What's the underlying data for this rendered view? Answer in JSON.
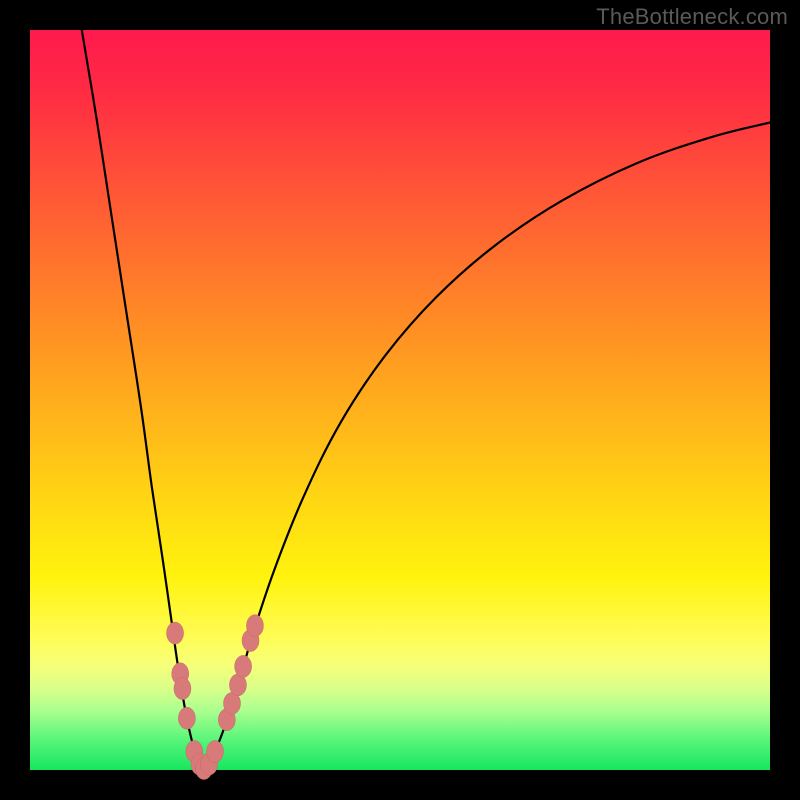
{
  "watermark": "TheBottleneck.com",
  "colors": {
    "frame": "#000000",
    "curve": "#000000",
    "marker_fill": "#d87a7a",
    "marker_stroke": "#c46868"
  },
  "chart_data": {
    "type": "line",
    "title": "",
    "xlabel": "",
    "ylabel": "",
    "xlim": [
      0,
      100
    ],
    "ylim": [
      0,
      100
    ],
    "note": "Axes are unlabeled in the image; coordinates below are read in percent of the inner plot area (0,0 = bottom-left, 100,100 = top-right).",
    "series": [
      {
        "name": "left-branch",
        "type": "line",
        "points": [
          {
            "x": 7.0,
            "y": 100.0
          },
          {
            "x": 9.0,
            "y": 88.0
          },
          {
            "x": 11.0,
            "y": 75.0
          },
          {
            "x": 13.0,
            "y": 62.0
          },
          {
            "x": 15.0,
            "y": 49.0
          },
          {
            "x": 16.5,
            "y": 38.0
          },
          {
            "x": 18.0,
            "y": 28.0
          },
          {
            "x": 19.0,
            "y": 21.0
          },
          {
            "x": 20.0,
            "y": 14.0
          },
          {
            "x": 21.0,
            "y": 8.0
          },
          {
            "x": 22.0,
            "y": 3.5
          },
          {
            "x": 23.0,
            "y": 0.8
          },
          {
            "x": 23.5,
            "y": 0.0
          }
        ]
      },
      {
        "name": "right-branch",
        "type": "line",
        "points": [
          {
            "x": 23.5,
            "y": 0.0
          },
          {
            "x": 24.5,
            "y": 1.5
          },
          {
            "x": 26.0,
            "y": 5.0
          },
          {
            "x": 28.0,
            "y": 11.0
          },
          {
            "x": 30.0,
            "y": 18.0
          },
          {
            "x": 33.0,
            "y": 27.0
          },
          {
            "x": 37.0,
            "y": 37.0
          },
          {
            "x": 42.0,
            "y": 47.0
          },
          {
            "x": 48.0,
            "y": 56.0
          },
          {
            "x": 55.0,
            "y": 64.0
          },
          {
            "x": 63.0,
            "y": 71.0
          },
          {
            "x": 72.0,
            "y": 77.0
          },
          {
            "x": 82.0,
            "y": 82.0
          },
          {
            "x": 92.0,
            "y": 85.5
          },
          {
            "x": 100.0,
            "y": 87.5
          }
        ]
      },
      {
        "name": "markers",
        "type": "scatter",
        "points": [
          {
            "x": 19.6,
            "y": 18.5
          },
          {
            "x": 20.3,
            "y": 13.0
          },
          {
            "x": 20.6,
            "y": 11.0
          },
          {
            "x": 21.2,
            "y": 7.0
          },
          {
            "x": 22.2,
            "y": 2.5
          },
          {
            "x": 22.9,
            "y": 0.8
          },
          {
            "x": 23.5,
            "y": 0.2
          },
          {
            "x": 24.2,
            "y": 0.8
          },
          {
            "x": 25.0,
            "y": 2.5
          },
          {
            "x": 26.6,
            "y": 6.8
          },
          {
            "x": 27.3,
            "y": 9.0
          },
          {
            "x": 28.1,
            "y": 11.5
          },
          {
            "x": 28.8,
            "y": 14.0
          },
          {
            "x": 29.8,
            "y": 17.5
          },
          {
            "x": 30.4,
            "y": 19.5
          }
        ]
      }
    ]
  }
}
